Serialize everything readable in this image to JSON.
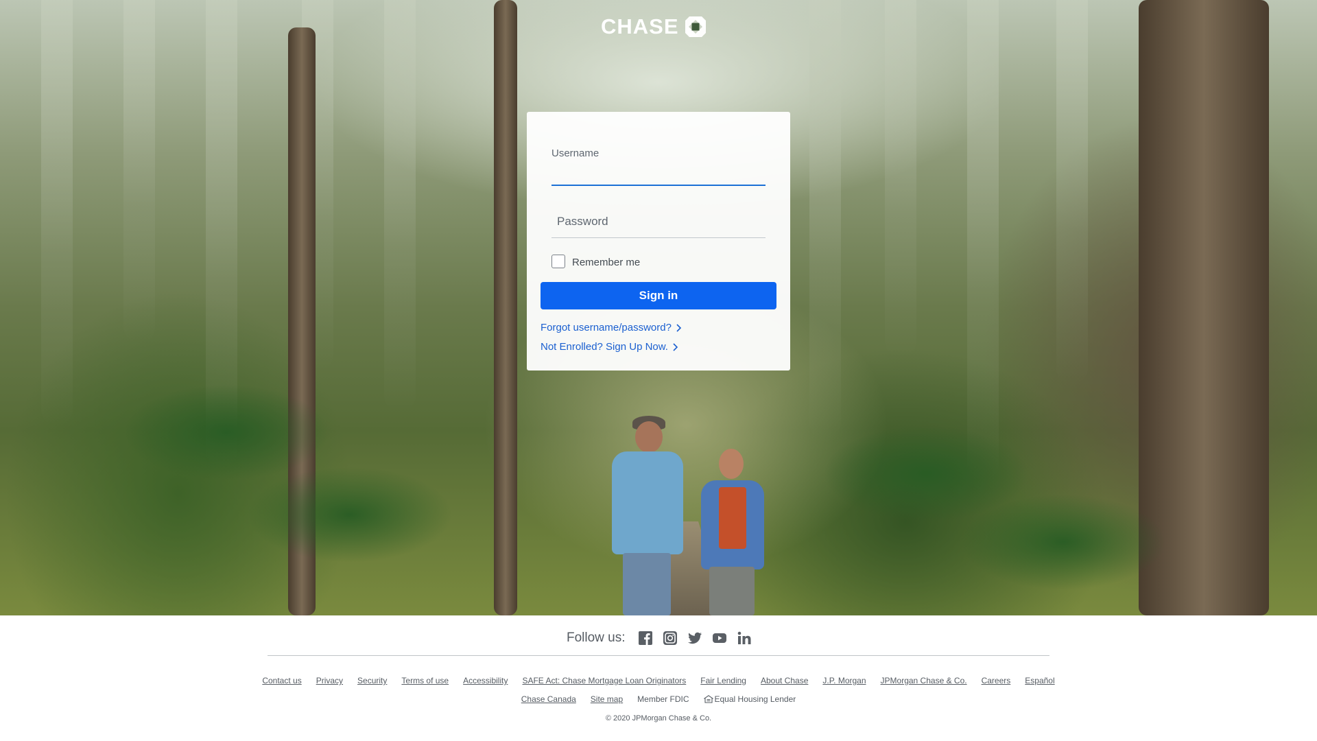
{
  "brand": {
    "name": "CHASE"
  },
  "login": {
    "username_label": "Username",
    "username_value": "",
    "password_label": "Password",
    "password_value": "",
    "remember_label": "Remember me",
    "remember_checked": false,
    "signin_label": "Sign in",
    "forgot_link": "Forgot username/password?",
    "enroll_link": "Not Enrolled? Sign Up Now."
  },
  "footer": {
    "follow_label": "Follow us:",
    "social": [
      {
        "icon": "facebook-icon"
      },
      {
        "icon": "instagram-icon"
      },
      {
        "icon": "twitter-icon"
      },
      {
        "icon": "youtube-icon"
      },
      {
        "icon": "linkedin-icon"
      }
    ],
    "links_row1": [
      "Contact us",
      "Privacy",
      "Security",
      "Terms of use",
      "Accessibility",
      "SAFE Act: Chase Mortgage Loan Originators",
      "Fair Lending",
      "About Chase",
      "J.P. Morgan",
      "JPMorgan Chase & Co.",
      "Careers",
      "Español"
    ],
    "links_row2": [
      "Chase Canada",
      "Site map"
    ],
    "member_fdic": "Member FDIC",
    "equal_housing": "Equal Housing Lender",
    "copyright": "© 2020 JPMorgan Chase & Co."
  },
  "colors": {
    "accent": "#0d64f0",
    "link": "#1a5fd0",
    "focus_underline": "#1a6fd6"
  }
}
